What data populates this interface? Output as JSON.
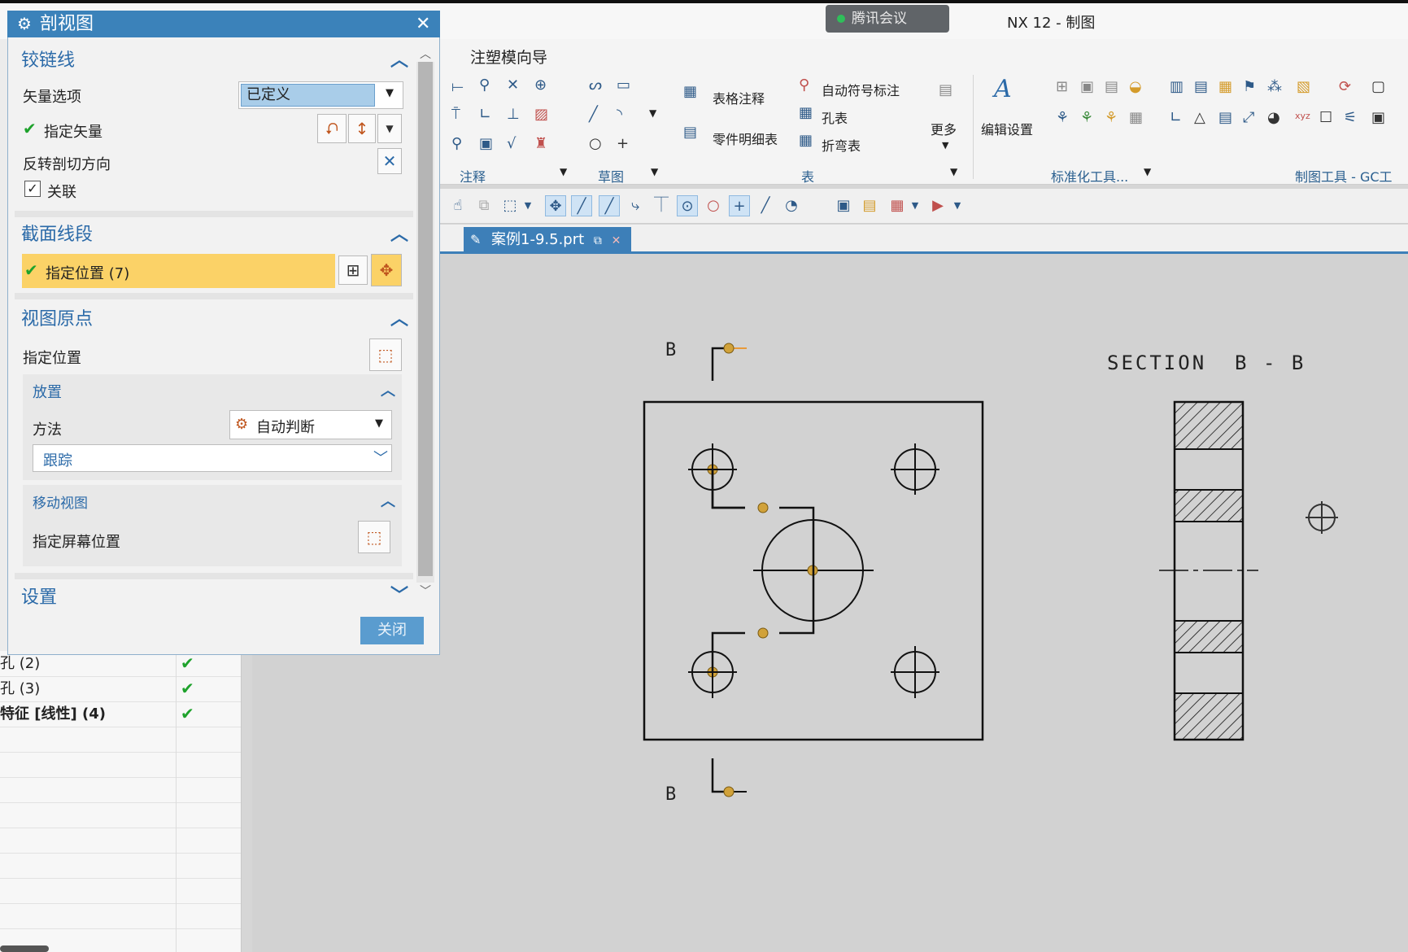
{
  "window": {
    "app_title": "NX 12 - 制图",
    "meeting_badge": "腾讯会议"
  },
  "ribbon": {
    "tab": "注塑模向导",
    "items": {
      "table_note": "表格注释",
      "parts_list": "零件明细表",
      "auto_symbol": "自动符号标注",
      "hole_table": "孔表",
      "bend_table": "折弯表",
      "more": "更多",
      "edit_settings": "编辑设置"
    },
    "groups": {
      "annotation": "注释",
      "sketch": "草图",
      "table": "表",
      "standard_tools": "标准化工具...",
      "drafting_tools": "制图工具 - GC工"
    }
  },
  "document_tab": {
    "name": "案例1-9.5.prt"
  },
  "dialog": {
    "title": "剖视图",
    "hinge_section": {
      "title": "铰链线",
      "vector_option_label": "矢量选项",
      "vector_option_value": "已定义",
      "specify_vector": "指定矢量",
      "reverse_direction": "反转剖切方向",
      "associative": "关联"
    },
    "segment_section": {
      "title": "截面线段",
      "specify_location": "指定位置 (7)"
    },
    "origin_section": {
      "title": "视图原点",
      "specify_location": "指定位置",
      "placement": {
        "title": "放置",
        "method_label": "方法",
        "method_value": "自动判断",
        "track_value": "跟踪"
      },
      "move_view": {
        "title": "移动视图",
        "specify_screen_location": "指定屏幕位置"
      }
    },
    "settings_section": {
      "title": "设置"
    },
    "close_button": "关闭"
  },
  "navigator": {
    "rows": [
      {
        "label": "孔 (2)",
        "status": "✔"
      },
      {
        "label": "孔 (3)",
        "status": "✔"
      },
      {
        "label": "特征 [线性] (4)",
        "status": "✔"
      }
    ]
  },
  "drawing": {
    "section_label_top": "B",
    "section_label_bottom": "B",
    "section_view_title": "SECTION  B - B"
  }
}
